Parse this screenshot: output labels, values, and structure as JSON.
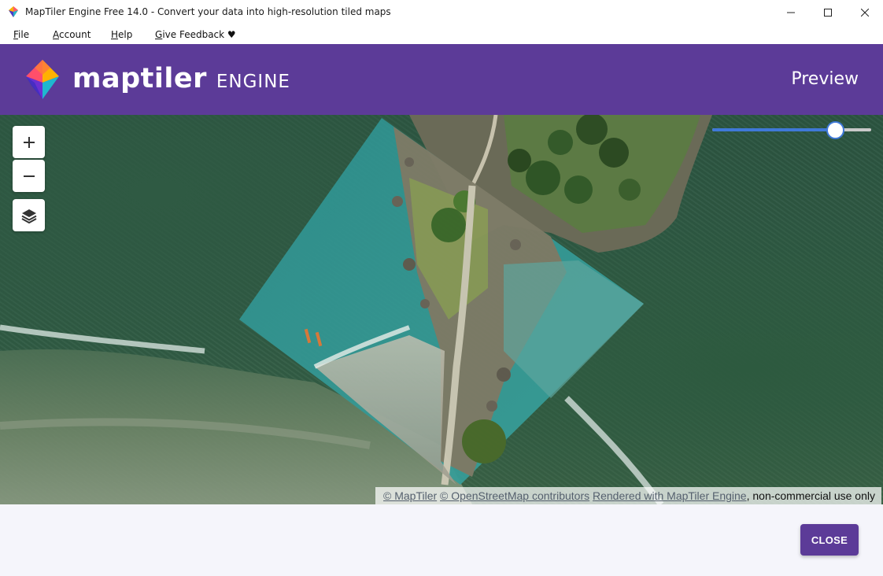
{
  "window": {
    "title": "MapTiler Engine Free 14.0 - Convert your data into high-resolution tiled maps"
  },
  "menu": {
    "items": [
      {
        "label": "File",
        "accel": "F",
        "rest": "ile"
      },
      {
        "label": "Account",
        "accel": "A",
        "rest": "ccount"
      },
      {
        "label": "Help",
        "accel": "H",
        "rest": "elp"
      },
      {
        "label": "Give Feedback ♥",
        "accel": "G",
        "rest": "ive Feedback ♥"
      }
    ]
  },
  "header": {
    "brand_main": "maptiler",
    "brand_sub": "ENGINE",
    "page_title": "Preview"
  },
  "map": {
    "controls": {
      "zoom_in_icon": "plus-icon",
      "zoom_out_icon": "minus-icon",
      "layers_icon": "layers-icon"
    },
    "opacity_slider": {
      "value": 0.77
    },
    "attribution": {
      "maptiler": "© MapTiler",
      "osm": "© OpenStreetMap contributors",
      "rendered": "Rendered with MapTiler Engine",
      "suffix": ", non-commercial use only"
    }
  },
  "footer": {
    "close_label": "CLOSE"
  },
  "colors": {
    "brand_purple": "#5c3b98",
    "slider_blue": "#3f79d8"
  }
}
